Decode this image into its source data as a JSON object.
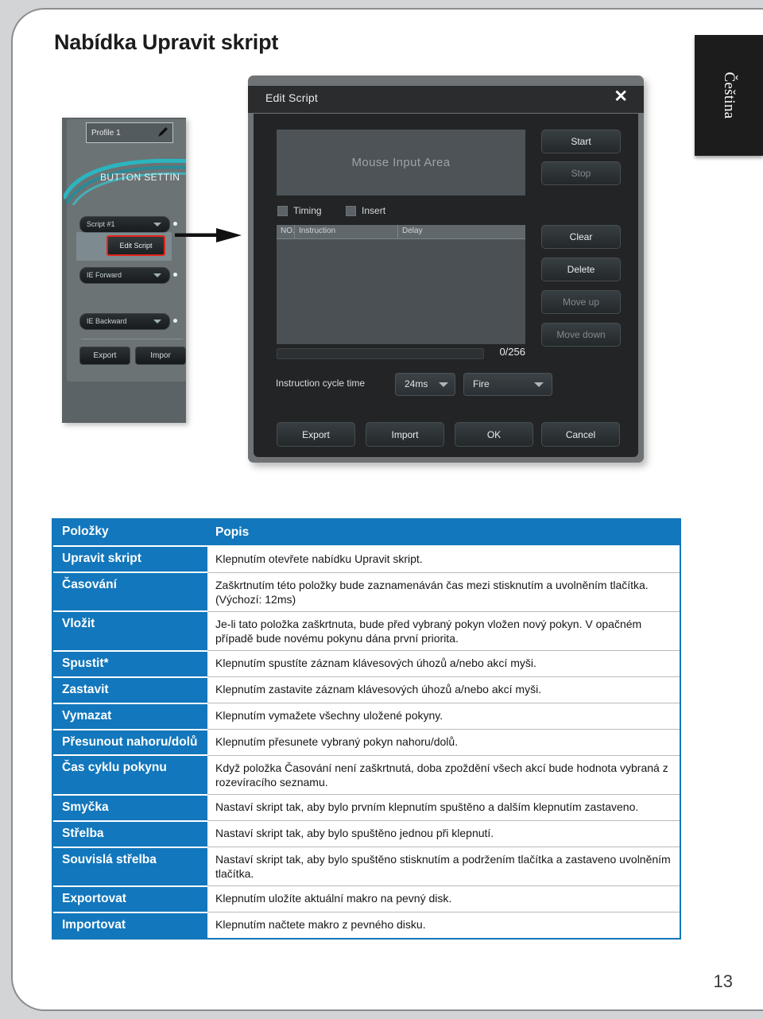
{
  "page": {
    "title": "Nabídka Upravit skript",
    "language_tab": "Čeština",
    "page_number": "13"
  },
  "screenshot": {
    "left_panel": {
      "profile_label": "Profile 1",
      "section_title": "BUTTON SETTIN",
      "dropdown_script": "Script #1",
      "edit_script_button": "Edit Script",
      "dropdown_forward": "IE Forward",
      "dropdown_backward": "IE Backward",
      "export_button": "Export",
      "import_button": "Impor"
    },
    "dialog": {
      "title": "Edit Script",
      "close_label": "✕",
      "mouse_input_area": "Mouse Input Area",
      "checkboxes": [
        {
          "label": "Timing",
          "checked": false
        },
        {
          "label": "Insert",
          "checked": false
        }
      ],
      "list_columns": [
        "NO.",
        "Instruction",
        "Delay"
      ],
      "counter": "0/256",
      "cycle_time_label": "Instruction cycle time",
      "cycle_time_value": "24ms",
      "mode_value": "Fire",
      "side_buttons": [
        {
          "label": "Start",
          "enabled": true
        },
        {
          "label": "Stop",
          "enabled": false
        },
        {
          "label": "Clear",
          "enabled": true
        },
        {
          "label": "Delete",
          "enabled": true
        },
        {
          "label": "Move up",
          "enabled": false
        },
        {
          "label": "Move down",
          "enabled": false
        }
      ],
      "footer_buttons": [
        "Export",
        "Import",
        "OK",
        "Cancel"
      ]
    }
  },
  "table": {
    "headers": [
      "Položky",
      "Popis"
    ],
    "rows": [
      {
        "item": "Upravit skript",
        "desc": "Klepnutím otevřete nabídku Upravit skript."
      },
      {
        "item": "Časování",
        "desc": "Zaškrtnutím této položky bude zaznamenáván čas mezi stisknutím a uvolněním tlačítka. (Výchozí: 12ms)"
      },
      {
        "item": "Vložit",
        "desc": "Je-li tato položka zaškrtnuta, bude před vybraný pokyn vložen nový pokyn. V opačném případě bude novému pokynu dána první priorita."
      },
      {
        "item": "Spustit*",
        "desc": "Klepnutím spustíte záznam klávesových úhozů a/nebo akcí myši."
      },
      {
        "item": "Zastavit",
        "desc": "Klepnutím zastavite záznam klávesových úhozů a/nebo akcí myši."
      },
      {
        "item": "Vymazat",
        "desc": "Klepnutím vymažete všechny uložené pokyny."
      },
      {
        "item": "Přesunout nahoru/dolů",
        "desc": "Klepnutím přesunete vybraný pokyn nahoru/dolů."
      },
      {
        "item": "Čas cyklu pokynu",
        "desc": "Když položka Časování není zaškrtnutá, doba zpoždění všech akcí bude hodnota vybraná z rozevíracího seznamu."
      },
      {
        "item": "Smyčka",
        "desc": "Nastaví skript tak, aby bylo prvním klepnutím spuštěno a dalším klepnutím zastaveno."
      },
      {
        "item": "Střelba",
        "desc": "Nastaví skript tak, aby bylo spuštěno jednou při klepnutí."
      },
      {
        "item": "Souvislá střelba",
        "desc": "Nastaví skript tak, aby bylo spuštěno stisknutím a podržením tlačítka a zastaveno uvolněním tlačítka."
      },
      {
        "item": "Exportovat",
        "desc": "Klepnutím uložíte aktuální makro na pevný disk."
      },
      {
        "item": "Importovat",
        "desc": "Klepnutím načtete makro z pevného disku."
      }
    ]
  },
  "colors": {
    "table_accent": "#1277bc",
    "tab_background": "#1c1c1c",
    "highlight_outline": "#e2231a"
  }
}
